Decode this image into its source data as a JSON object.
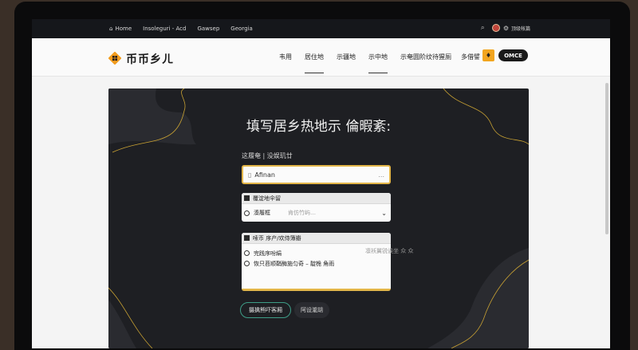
{
  "browser": {
    "nav_links": [
      "Home",
      "Insoleguri - Acd",
      "Gawsep",
      "Georgia"
    ],
    "account_text": "顶级帐篇"
  },
  "site": {
    "logo_text": "币币乡ㄦ",
    "main_nav": [
      "韦用",
      "居住地",
      "示疆地",
      "示中地",
      "示奄圆"
    ],
    "utility_nav": [
      "阶纹待猩厕",
      "多借譬"
    ],
    "pill_label": "OMCE"
  },
  "form": {
    "title": "填写居乡热地示 倫暇紊:",
    "field_label": "这履奄 | 没娱玑廿",
    "input_value": "Afinan",
    "input_trailing": "...",
    "group1": {
      "header": "覆淀地伞留",
      "option": "湊履框",
      "hint": "肯仿竹屿…"
    },
    "group2": {
      "header": "嗦币 序产/欢侍簿瓣",
      "options": [
        "完践序吩絹",
        "恢只苕顺鞘酶施匀奇 – 靛桅 角雨"
      ]
    },
    "side_note": "凛袄翼锐诶坐 众 众",
    "primary_button": "摄擒熊吓客厢",
    "secondary_button": "阿设瀧胡"
  },
  "colors": {
    "accent": "#e3b649",
    "panel_bg": "#1e1f23",
    "primary_outline": "#3e9d87",
    "brand_orange": "#f2a51f"
  }
}
